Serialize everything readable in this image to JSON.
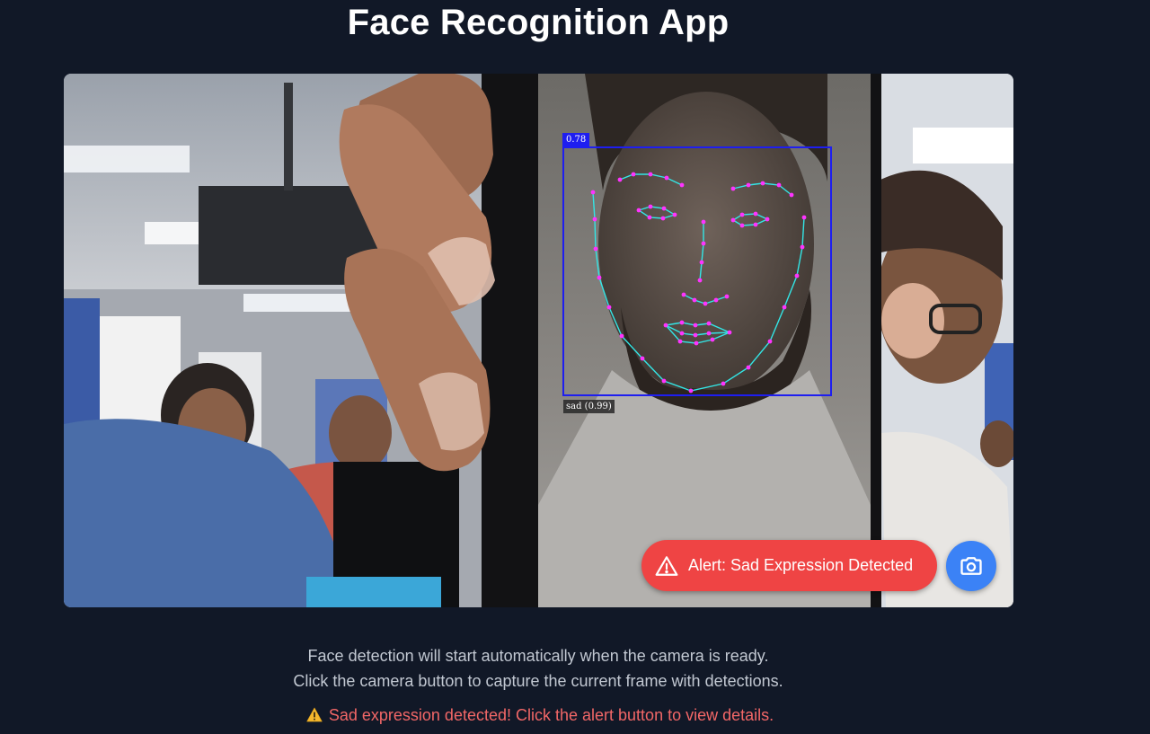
{
  "app": {
    "title": "Face Recognition App"
  },
  "detection": {
    "score_label": "0.78",
    "expression_label": "sad (0.99)",
    "box_color": "#1e1ef0",
    "landmark_color": "#ff33ff",
    "contour_color": "#33e6e6"
  },
  "controls": {
    "alert_label": "Alert: Sad Expression Detected",
    "alert_icon": "warning-triangle-icon",
    "alert_color": "#ef4444",
    "capture_icon": "camera-icon",
    "capture_color": "#3b82f6"
  },
  "info": {
    "line1": "Face detection will start automatically when the camera is ready.",
    "line2": "Click the camera button to capture the current frame with detections.",
    "warning": "Sad expression detected! Click the alert button to view details.",
    "warning_icon": "warning-emoji-icon",
    "warning_color": "#f26767"
  }
}
